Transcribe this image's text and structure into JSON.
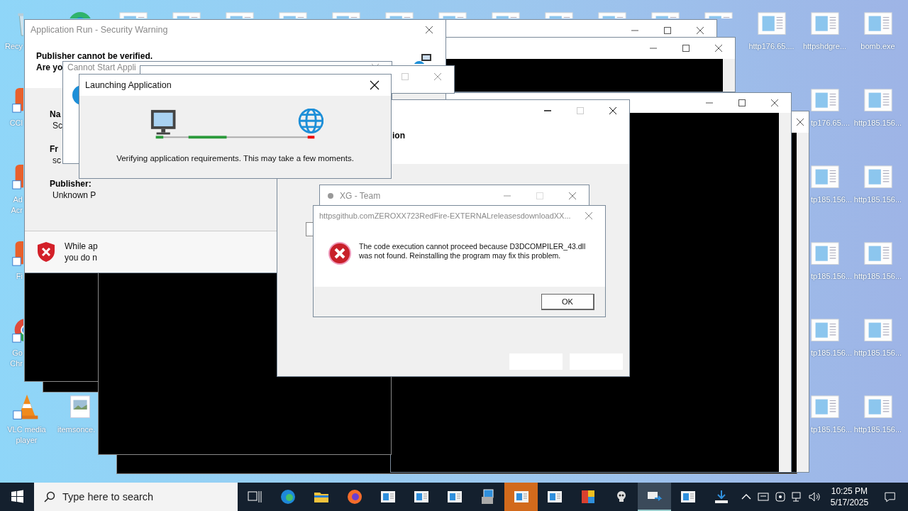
{
  "desktop": {
    "icons": [
      {
        "kind": "recycle-bin",
        "lines": [
          "Recy"
        ]
      },
      {
        "kind": "edge"
      },
      {
        "kind": "web-file"
      },
      {
        "kind": "web-file"
      },
      {
        "kind": "web-file"
      },
      {
        "kind": "web-file"
      },
      {
        "kind": "web-file"
      },
      {
        "kind": "web-file"
      },
      {
        "kind": "web-file"
      },
      {
        "kind": "web-file"
      },
      {
        "kind": "web-file"
      },
      {
        "kind": "web-file"
      },
      {
        "kind": "web-file"
      },
      {
        "kind": "web-file"
      },
      {
        "kind": "web-file",
        "lines": [
          "http176.65...."
        ]
      },
      {
        "kind": "web-file",
        "lines": [
          "httpshdgre..."
        ]
      },
      {
        "kind": "web-file",
        "lines": [
          "bomb.exe"
        ]
      },
      {
        "kind": "app",
        "lines": [
          "CCl"
        ]
      },
      {
        "kind": "web-file",
        "lines": [
          "tp176.65...."
        ]
      },
      {
        "kind": "web-file",
        "lines": [
          "http185.156..."
        ]
      },
      {
        "kind": "app",
        "lines": [
          "Ad",
          "Acr"
        ]
      },
      {
        "kind": "web-file",
        "lines": [
          "tp185.156..."
        ]
      },
      {
        "kind": "web-file",
        "lines": [
          "http185.156..."
        ]
      },
      {
        "kind": "app",
        "lines": [
          "Fi"
        ]
      },
      {
        "kind": "web-file",
        "lines": [
          "tp185.156..."
        ]
      },
      {
        "kind": "web-file",
        "lines": [
          "http185.156..."
        ]
      },
      {
        "kind": "chrome",
        "lines": [
          "Go",
          "Chr"
        ]
      },
      {
        "kind": "web-file",
        "lines": [
          "tp185.156..."
        ]
      },
      {
        "kind": "web-file",
        "lines": [
          "http185.156..."
        ]
      },
      {
        "kind": "vlc",
        "lines": [
          "VLC media",
          "player"
        ]
      },
      {
        "kind": "image",
        "lines": [
          "itemsonce."
        ]
      },
      {
        "kind": "web-file",
        "lines": [
          "tp185.156..."
        ]
      },
      {
        "kind": "web-file",
        "lines": [
          "http185.156..."
        ]
      }
    ]
  },
  "security_warning": {
    "title": "Application Run - Security Warning",
    "heading": "Publisher cannot be verified.",
    "question": "Are yo",
    "fields": [
      {
        "label": "Na",
        "value": "Sc"
      },
      {
        "label": "Fr",
        "value": "sc"
      },
      {
        "label": "Publisher:",
        "value": "Unknown P"
      }
    ],
    "footer": [
      "While ap",
      "you do n"
    ]
  },
  "cannot_start": {
    "title": "Cannot Start Appli"
  },
  "launching": {
    "title": "Launching Application",
    "message": "Verifying application requirements. This may take a few moments."
  },
  "setup": {
    "heading": "ion"
  },
  "xg_team": {
    "title": "XG - Team"
  },
  "error_dialog": {
    "title": "httpsgithub.comZEROXX723RedFire-EXTERNALreleasesdownloadXX...",
    "message": "The code execution cannot proceed because D3DCOMPILER_43.dll was not found. Reinstalling the program may fix this problem.",
    "button": "OK"
  },
  "taskbar": {
    "search": {
      "placeholder": "Type here to search"
    },
    "apps": [
      {
        "kind": "task-view",
        "active": false,
        "flashing": false
      },
      {
        "kind": "edge",
        "active": false,
        "flashing": false
      },
      {
        "kind": "folder",
        "active": false,
        "flashing": false
      },
      {
        "kind": "firefox",
        "active": false,
        "flashing": false
      },
      {
        "kind": "window",
        "active": false,
        "flashing": false
      },
      {
        "kind": "window",
        "active": false,
        "flashing": false
      },
      {
        "kind": "window",
        "active": false,
        "flashing": false
      },
      {
        "kind": "installer",
        "active": false,
        "flashing": false
      },
      {
        "kind": "window",
        "active": false,
        "flashing": true
      },
      {
        "kind": "window",
        "active": false,
        "flashing": false
      },
      {
        "kind": "colorful",
        "active": false,
        "flashing": false
      },
      {
        "kind": "skull",
        "active": false,
        "flashing": false
      },
      {
        "kind": "transfer",
        "active": true,
        "flashing": false
      },
      {
        "kind": "window",
        "active": false,
        "flashing": false
      },
      {
        "kind": "download",
        "active": false,
        "flashing": false
      }
    ],
    "time": "10:25 PM",
    "date": "5/17/2025"
  }
}
